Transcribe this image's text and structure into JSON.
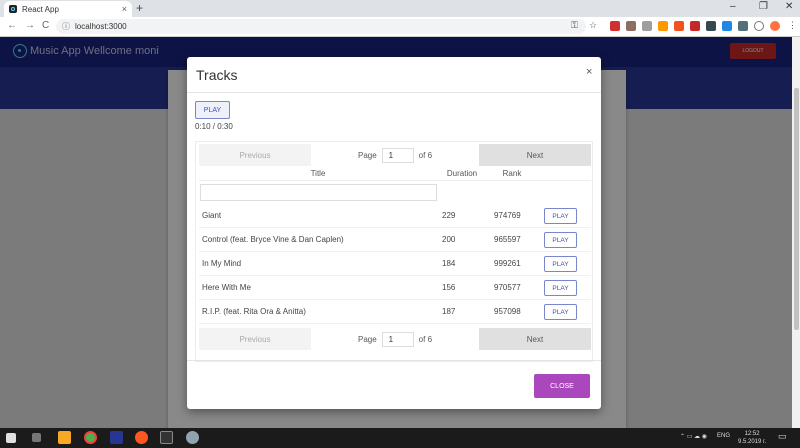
{
  "browser": {
    "tab_title": "React App",
    "tab_close": "×",
    "new_tab": "+",
    "window_controls": {
      "minimize": "–",
      "maximize": "❐",
      "close": "✕"
    },
    "url": "localhost:3000",
    "nav": {
      "back": "←",
      "forward": "→",
      "reload": "C"
    },
    "menu": "⋮"
  },
  "app": {
    "title": "Music App Wellcome moni",
    "logout_label": "LOGOUT"
  },
  "modal": {
    "title": "Tracks",
    "close": "×",
    "play_label": "PLAY",
    "time": "0:10 / 0:30",
    "pager": {
      "previous": "Previous",
      "page_label": "Page",
      "page_value": "1",
      "of_label": "of 6",
      "next": "Next"
    },
    "columns": {
      "title": "Title",
      "duration": "Duration",
      "rank": "Rank"
    },
    "rows": [
      {
        "title": "Giant",
        "duration": "229",
        "rank": "974769",
        "action": "PLAY"
      },
      {
        "title": "Control (feat. Bryce Vine & Dan Caplen)",
        "duration": "200",
        "rank": "965597",
        "action": "PLAY"
      },
      {
        "title": "In My Mind",
        "duration": "184",
        "rank": "999261",
        "action": "PLAY"
      },
      {
        "title": "Here With Me",
        "duration": "156",
        "rank": "970577",
        "action": "PLAY"
      },
      {
        "title": "R.I.P. (feat. Rita Ora & Anitta)",
        "duration": "187",
        "rank": "957098",
        "action": "PLAY"
      }
    ],
    "close_button": "CLOSE"
  },
  "taskbar": {
    "language": "ENG",
    "time": "12:52",
    "date": "9.5.2019 г."
  },
  "colors": {
    "navbar": "#1a237e",
    "logout": "#c62828",
    "close_button": "#ab47bc",
    "play_accent": "#3f51b5"
  }
}
